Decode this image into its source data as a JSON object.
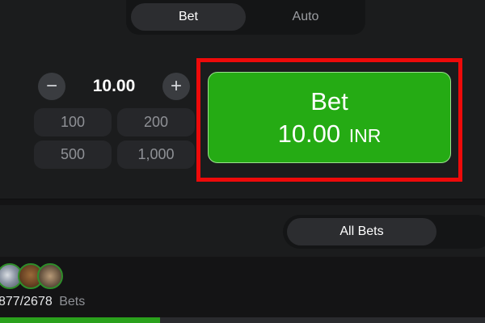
{
  "mode_tabs": {
    "bet_label": "Bet",
    "auto_label": "Auto"
  },
  "bet_amount": {
    "minus_symbol": "−",
    "value": "10.00",
    "plus_symbol": "+",
    "quick_amounts": [
      "100",
      "200",
      "500",
      "1,000"
    ]
  },
  "bet_button": {
    "title": "Bet",
    "amount": "10.00",
    "currency": "INR"
  },
  "bets_tabs": {
    "active_label": "All Bets"
  },
  "stats": {
    "count": "877/2678",
    "label": "Bets",
    "progress_fraction": 0.33
  },
  "colors": {
    "bet_button_green": "#25ab14",
    "highlight_red": "#ee0a0a",
    "background": "#1b1c1d",
    "progress_green": "#2aa11c"
  },
  "icons": [
    "minus-icon",
    "plus-icon"
  ]
}
